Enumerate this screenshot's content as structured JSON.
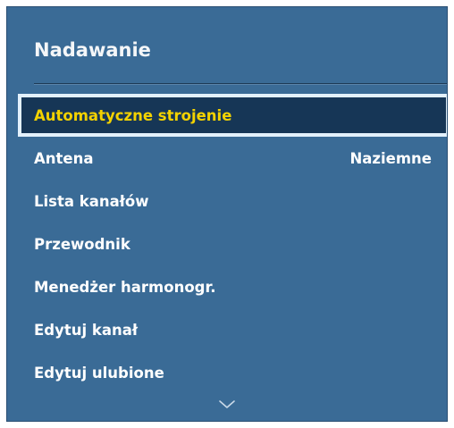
{
  "menu": {
    "title": "Nadawanie",
    "items": [
      {
        "label": "Automatyczne strojenie",
        "value": "",
        "selected": true
      },
      {
        "label": "Antena",
        "value": "Naziemne",
        "selected": false
      },
      {
        "label": "Lista kanałów",
        "value": "",
        "selected": false
      },
      {
        "label": "Przewodnik",
        "value": "",
        "selected": false
      },
      {
        "label": "Menedżer harmonogr.",
        "value": "",
        "selected": false
      },
      {
        "label": "Edytuj kanał",
        "value": "",
        "selected": false
      },
      {
        "label": "Edytuj ulubione",
        "value": "",
        "selected": false
      }
    ],
    "scroll_icon": "chevron-down-icon"
  },
  "colors": {
    "panel_background": "#3a6b96",
    "selected_background": "#163656",
    "selected_border": "#e3f1fc",
    "selected_text": "#f3d200",
    "title_text": "#f4f6f8",
    "item_text": "#ffffff"
  }
}
